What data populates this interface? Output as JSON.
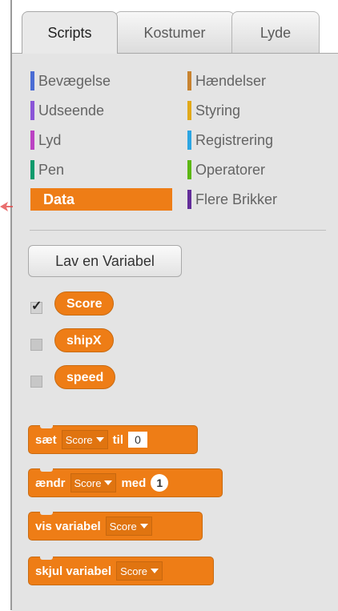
{
  "tabs": [
    {
      "label": "Scripts",
      "active": true
    },
    {
      "label": "Kostumer",
      "active": false
    },
    {
      "label": "Lyde",
      "active": false
    }
  ],
  "categories": [
    {
      "label": "Bevægelse",
      "color": "#4a6cd4"
    },
    {
      "label": "Udseende",
      "color": "#8a55d7"
    },
    {
      "label": "Lyd",
      "color": "#bb42c3"
    },
    {
      "label": "Pen",
      "color": "#0e9a6c"
    },
    {
      "label": "Data",
      "color": "#ee7d16",
      "selected": true
    },
    {
      "label": "Hændelser",
      "color": "#c88330"
    },
    {
      "label": "Styring",
      "color": "#e1a91a"
    },
    {
      "label": "Registrering",
      "color": "#2ca5e2"
    },
    {
      "label": "Operatorer",
      "color": "#5cb712"
    },
    {
      "label": "Flere Brikker",
      "color": "#632d99"
    }
  ],
  "make_variable_button": "Lav en Variabel",
  "variables": [
    {
      "name": "Score",
      "checked": true
    },
    {
      "name": "shipX",
      "checked": false
    },
    {
      "name": "speed",
      "checked": false
    }
  ],
  "blocks": {
    "set": {
      "label": "sæt",
      "var": "Score",
      "to": "til",
      "value": "0"
    },
    "change": {
      "label": "ændr",
      "var": "Score",
      "by": "med",
      "value": "1"
    },
    "show": {
      "label": "vis variabel",
      "var": "Score"
    },
    "hide": {
      "label": "skjul variabel",
      "var": "Score"
    }
  },
  "colors": {
    "accent": "#ee7d16"
  }
}
